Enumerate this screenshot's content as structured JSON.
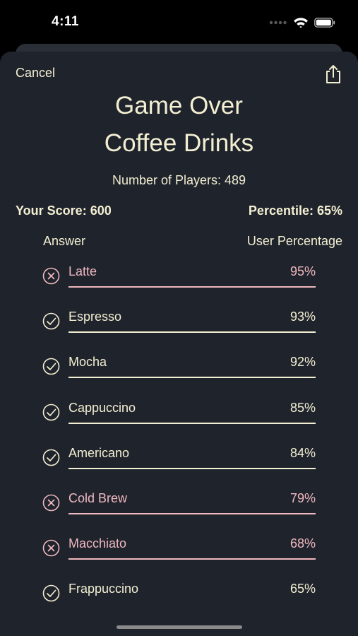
{
  "status_bar": {
    "time": "4:11"
  },
  "header": {
    "cancel_label": "Cancel",
    "share_icon": "share-icon"
  },
  "title_line1": "Game Over",
  "title_line2": "Coffee Drinks",
  "players_text": "Number of Players: 489",
  "score_text": "Your Score: 600",
  "percentile_text": "Percentile: 65%",
  "columns": {
    "answer": "Answer",
    "user_percentage": "User Percentage"
  },
  "colors": {
    "correct": "#f3efd2",
    "incorrect": "#f0b8c0",
    "background": "#1f232c"
  },
  "answers": [
    {
      "name": "Latte",
      "percent": "95%",
      "status": "incorrect"
    },
    {
      "name": "Espresso",
      "percent": "93%",
      "status": "correct"
    },
    {
      "name": "Mocha",
      "percent": "92%",
      "status": "correct"
    },
    {
      "name": "Cappuccino",
      "percent": "85%",
      "status": "correct"
    },
    {
      "name": "Americano",
      "percent": "84%",
      "status": "correct"
    },
    {
      "name": "Cold Brew",
      "percent": "79%",
      "status": "incorrect"
    },
    {
      "name": "Macchiato",
      "percent": "68%",
      "status": "incorrect"
    },
    {
      "name": "Frappuccino",
      "percent": "65%",
      "status": "correct"
    }
  ]
}
